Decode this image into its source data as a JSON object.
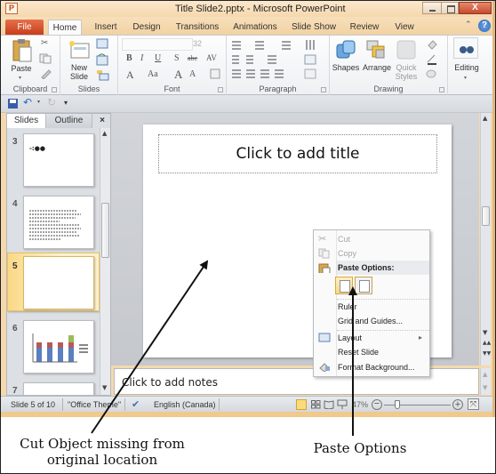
{
  "window": {
    "app_icon_letter": "P",
    "title": "Title Slide2.pptx - Microsoft PowerPoint",
    "close_label": "X"
  },
  "ribbon_tabs": [
    {
      "label": "File"
    },
    {
      "label": "Home"
    },
    {
      "label": "Insert"
    },
    {
      "label": "Design"
    },
    {
      "label": "Transitions"
    },
    {
      "label": "Animations"
    },
    {
      "label": "Slide Show"
    },
    {
      "label": "Review"
    },
    {
      "label": "View"
    }
  ],
  "help_label": "?",
  "ribbon": {
    "clipboard": {
      "label": "Clipboard",
      "paste": "Paste"
    },
    "slides": {
      "label": "Slides",
      "new_slide_1": "New",
      "new_slide_2": "Slide"
    },
    "font": {
      "label": "Font",
      "font_name": "",
      "font_size": "32",
      "bold": "B",
      "italic": "I",
      "underline": "U",
      "shadow": "S",
      "strike": "abc",
      "spacing": "AV",
      "color": "A",
      "change_case": "Aa",
      "grow": "A",
      "shrink": "A"
    },
    "paragraph": {
      "label": "Paragraph"
    },
    "drawing": {
      "label": "Drawing",
      "shapes": "Shapes",
      "arrange": "Arrange",
      "quick_styles_1": "Quick",
      "quick_styles_2": "Styles"
    },
    "editing": {
      "label": "Editing"
    }
  },
  "pane": {
    "tabs": [
      {
        "label": "Slides"
      },
      {
        "label": "Outline"
      },
      {
        "label": "×"
      }
    ],
    "thumbnails": [
      {
        "number": "3"
      },
      {
        "number": "4"
      },
      {
        "number": "5",
        "selected": true
      },
      {
        "number": "6"
      },
      {
        "number": "7"
      }
    ]
  },
  "slide": {
    "title_placeholder": "Click to add title"
  },
  "notes": {
    "placeholder": "Click to add notes"
  },
  "context_menu": {
    "items": [
      {
        "label": "Cut",
        "disabled": true
      },
      {
        "label": "Copy",
        "disabled": true
      },
      {
        "label": "Paste Options:",
        "header": true
      },
      {
        "label": "Ruler"
      },
      {
        "label": "Grid and Guides..."
      },
      {
        "label": "Layout",
        "submenu": true
      },
      {
        "label": "Reset Slide"
      },
      {
        "label": "Format Background..."
      }
    ],
    "submenu_arrow": "▸"
  },
  "status_bar": {
    "slide_info": "Slide 5 of 10",
    "theme": "\"Office Theme\"",
    "language": "English (Canada)",
    "zoom": "47%",
    "zoom_fraction": 0.47
  },
  "annotations": {
    "left_line1": "Cut Object missing from",
    "left_line2": "original location",
    "right": "Paste Options"
  }
}
